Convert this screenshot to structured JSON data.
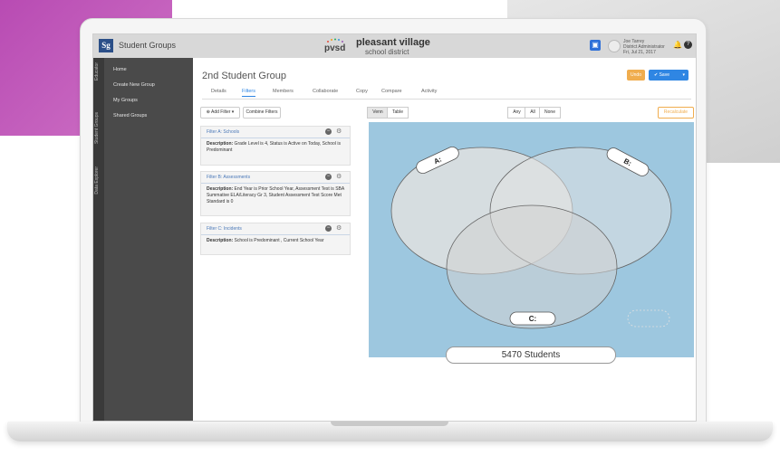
{
  "app": {
    "logo": "Sg",
    "title": "Student Groups",
    "brand_short": "pvsd",
    "brand_name": "pleasant village",
    "brand_sub": "school district"
  },
  "user": {
    "name": "Joe Tarrey",
    "details": "District Administrator",
    "date": "Fri, Jul 21, 2017"
  },
  "sidebar": {
    "rail_tabs": [
      "Student Groups",
      "Data Explorer",
      "Educator"
    ],
    "items": [
      {
        "label": "Home"
      },
      {
        "label": "Create New Group"
      },
      {
        "label": "My Groups"
      },
      {
        "label": "Shared Groups"
      }
    ]
  },
  "page": {
    "title": "2nd Student Group",
    "undo_label": "Undo",
    "save_label": "✔ Save",
    "tabs": [
      {
        "label": "Details"
      },
      {
        "label": "Filters",
        "active": true
      },
      {
        "label": "Members"
      },
      {
        "label": "Collaborate"
      },
      {
        "label": "Copy"
      },
      {
        "label": "Compare"
      },
      {
        "label": "Activity"
      }
    ]
  },
  "toolbar": {
    "add_filter": "⊕ Add Filter ▾",
    "combine_filters": "Combine Filters",
    "view_venn": "Venn",
    "view_table": "Table",
    "any": "Any",
    "all": "All",
    "none": "None",
    "recalculate": "Recalculate"
  },
  "filters": [
    {
      "title": "Filter A: Schools",
      "desc_label": "Description:",
      "desc": " Grade Level is 4, Status is Active on Today, School is Predominant"
    },
    {
      "title": "Filter B: Assessments",
      "desc_label": "Description:",
      "desc": " End Year is Prior School Year, Assessment Test is SBA Summative ELA/Literacy Gr 3, Student Assessment Test Score Met Standard is 0"
    },
    {
      "title": "Filter C: Incidents",
      "desc_label": "Description:",
      "desc": " School is Predominant , Current School Year"
    }
  ],
  "venn": {
    "label_a": "A:",
    "label_b": "B:",
    "label_c": "C:",
    "count_text": "5470 Students"
  }
}
